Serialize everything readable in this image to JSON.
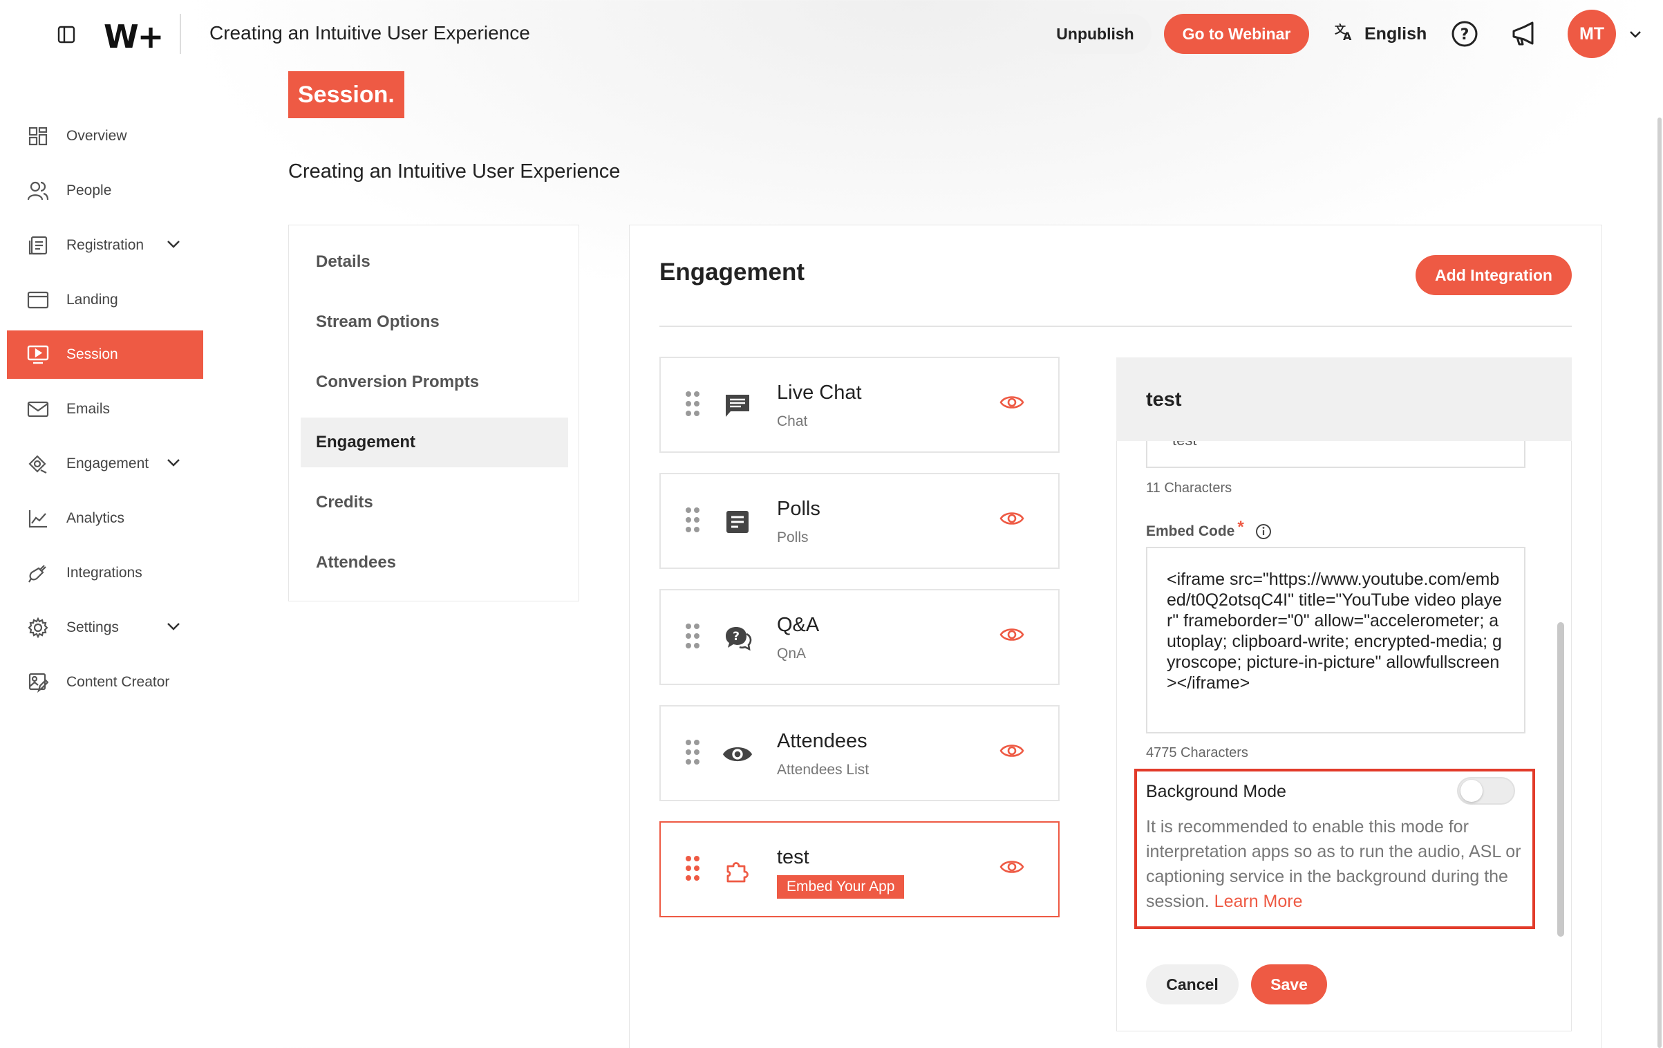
{
  "header": {
    "title": "Creating an Intuitive User Experience",
    "logo": "W+",
    "unpublish_label": "Unpublish",
    "webinar_label": "Go to Webinar",
    "language": "English",
    "avatar_initials": "MT"
  },
  "sidebar": {
    "items": [
      {
        "label": "Overview",
        "icon": "grid-icon"
      },
      {
        "label": "People",
        "icon": "people-icon"
      },
      {
        "label": "Registration",
        "icon": "registration-icon",
        "expandable": true
      },
      {
        "label": "Landing",
        "icon": "browser-window-icon"
      },
      {
        "label": "Session",
        "icon": "play-screen-icon",
        "active": true
      },
      {
        "label": "Emails",
        "icon": "mail-icon"
      },
      {
        "label": "Engagement",
        "icon": "engagement-icon",
        "expandable": true
      },
      {
        "label": "Analytics",
        "icon": "line-chart-icon"
      },
      {
        "label": "Integrations",
        "icon": "plug-icon"
      },
      {
        "label": "Settings",
        "icon": "gear-icon",
        "expandable": true
      },
      {
        "label": "Content Creator",
        "icon": "content-creator-icon"
      }
    ]
  },
  "page": {
    "tag": "Session.",
    "subtitle": "Creating an Intuitive User Experience"
  },
  "session_menu": {
    "items": [
      "Details",
      "Stream Options",
      "Conversion Prompts",
      "Engagement",
      "Credits",
      "Attendees"
    ],
    "active": "Engagement"
  },
  "engagement": {
    "title": "Engagement",
    "add_label": "Add Integration",
    "integrations": [
      {
        "name": "Live Chat",
        "sub": "Chat",
        "icon": "chat-icon"
      },
      {
        "name": "Polls",
        "sub": "Polls",
        "icon": "poll-icon"
      },
      {
        "name": "Q&A",
        "sub": "QnA",
        "icon": "qna-icon"
      },
      {
        "name": "Attendees",
        "sub": "Attendees List",
        "icon": "eye-icon"
      },
      {
        "name": "test",
        "tag": "Embed Your App",
        "icon": "puzzle-icon",
        "selected": true
      }
    ]
  },
  "detail": {
    "title": "test",
    "name_value": "test",
    "name_chars": "11 Characters",
    "embed_label": "Embed Code",
    "embed_required": "*",
    "embed_code": "<iframe src=\"https://www.youtube.com/embed/t0Q2otsqC4I\" title=\"YouTube video player\" frameborder=\"0\" allow=\"accelerometer; autoplay; clipboard-write; encrypted-media; gyroscope; picture-in-picture\" allowfullscreen></iframe>",
    "embed_chars": "4775 Characters",
    "bg_label": "Background Mode",
    "bg_enabled": false,
    "bg_desc": "It is recommended to enable this mode for interpretation apps so as to run the audio, ASL or captioning service in the background during the session.",
    "learn_more": "Learn More",
    "cancel_label": "Cancel",
    "save_label": "Save"
  },
  "colors": {
    "accent": "#ee5a44",
    "highlight_border": "#e23b2a"
  }
}
